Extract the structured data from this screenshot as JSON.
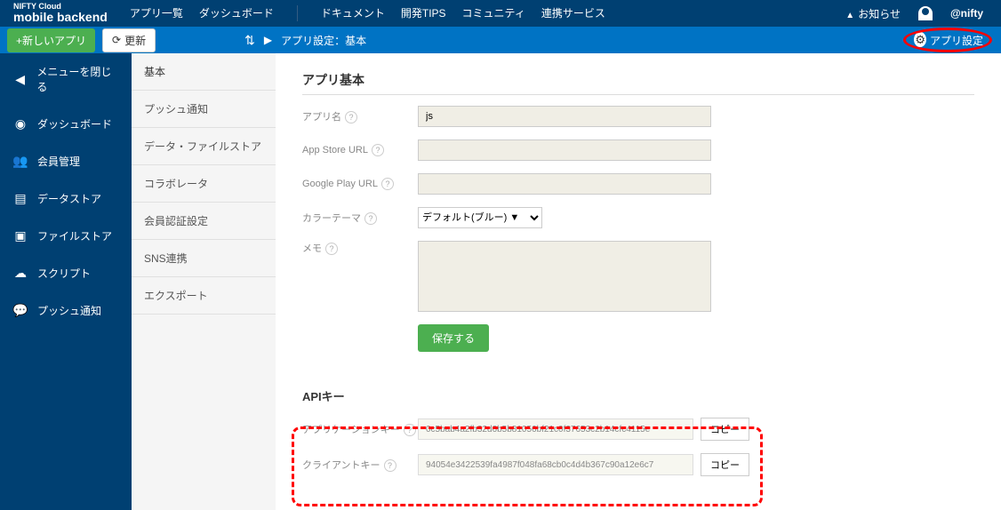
{
  "header": {
    "logo_sub": "NIFTY Cloud",
    "logo": "mobile backend",
    "nav": [
      "アプリ一覧",
      "ダッシュボード",
      "ドキュメント",
      "開発TIPS",
      "コミュニティ",
      "連携サービス"
    ],
    "notice": "お知らせ",
    "brand": "@nifty"
  },
  "subheader": {
    "new_app": "+新しいアプリ",
    "refresh": "更新",
    "breadcrumb": "アプリ設定：基本",
    "settings": "アプリ設定"
  },
  "sidebar": {
    "items": [
      {
        "label": "メニューを閉じる",
        "icon": "◀"
      },
      {
        "label": "ダッシュボード",
        "icon": "◉"
      },
      {
        "label": "会員管理",
        "icon": "👥"
      },
      {
        "label": "データストア",
        "icon": "▤"
      },
      {
        "label": "ファイルストア",
        "icon": "▣"
      },
      {
        "label": "スクリプト",
        "icon": "☁"
      },
      {
        "label": "プッシュ通知",
        "icon": "💬"
      }
    ]
  },
  "subsidebar": {
    "items": [
      "基本",
      "プッシュ通知",
      "データ・ファイルストア",
      "コラボレータ",
      "会員認証設定",
      "SNS連携",
      "エクスポート"
    ]
  },
  "main": {
    "title": "アプリ基本",
    "app_name_label": "アプリ名",
    "app_name_value": "js",
    "appstore_label": "App Store URL",
    "googleplay_label": "Google Play URL",
    "theme_label": "カラーテーマ",
    "theme_value": "デフォルト(ブルー) ▼",
    "memo_label": "メモ",
    "save": "保存する",
    "api_title": "APIキー",
    "app_key_label": "アプリケーションキー",
    "app_key_value": "0c5bab4a2fb32d6b5b81056bf21c0f37653c2b14cfc4115e",
    "client_key_label": "クライアントキー",
    "client_key_value": "94054e3422539fa4987f048fa68cb0c4d4b367c90a12e6c7",
    "copy": "コピー"
  }
}
